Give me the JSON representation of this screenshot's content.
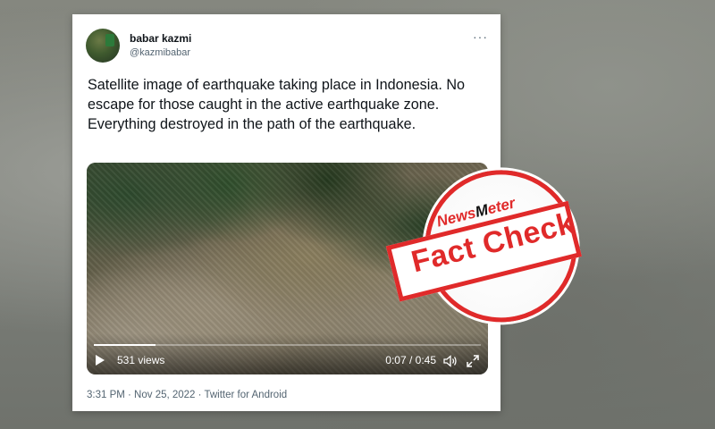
{
  "tweet": {
    "author_name": "babar kazmi",
    "author_handle": "@kazmibabar",
    "more_label": "···",
    "text": "Satellite image of earthquake taking place in Indonesia. No escape for those caught in the active earthquake zone. Everything destroyed in the path of the earthquake.",
    "meta": "3:31 PM · Nov 25, 2022 · Twitter for Android"
  },
  "video": {
    "views": "531 views",
    "time": "0:07 / 0:45",
    "progress": 0.16,
    "icons": [
      "play-icon",
      "volume-icon",
      "fullscreen-icon"
    ]
  },
  "stamp": {
    "brand_left": "News",
    "brand_right": "eter",
    "label": "Fact Check",
    "color": "#e02a2a"
  }
}
